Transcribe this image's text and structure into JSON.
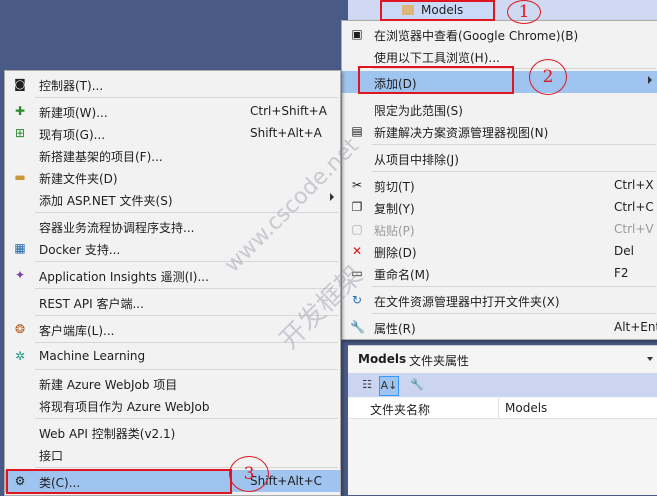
{
  "solution": {
    "models_label": "Models"
  },
  "right_menu": {
    "items": [
      {
        "label": "在浏览器中查看(Google Chrome)(B)",
        "shortcut": "",
        "icon": "browser-icon"
      },
      {
        "label": "使用以下工具浏览(H)...",
        "shortcut": "",
        "icon": ""
      },
      {
        "label": "添加(D)",
        "shortcut": "",
        "icon": ""
      },
      {
        "label": "限定为此范围(S)",
        "shortcut": "",
        "icon": ""
      },
      {
        "label": "新建解决方案资源管理器视图(N)",
        "shortcut": "",
        "icon": "solution-view-icon"
      },
      {
        "label": "从项目中排除(J)",
        "shortcut": "",
        "icon": ""
      },
      {
        "label": "剪切(T)",
        "shortcut": "Ctrl+X",
        "icon": "cut-icon"
      },
      {
        "label": "复制(Y)",
        "shortcut": "Ctrl+C",
        "icon": "copy-icon"
      },
      {
        "label": "粘贴(P)",
        "shortcut": "Ctrl+V",
        "icon": "paste-icon"
      },
      {
        "label": "删除(D)",
        "shortcut": "Del",
        "icon": "delete-icon"
      },
      {
        "label": "重命名(M)",
        "shortcut": "F2",
        "icon": "rename-icon"
      },
      {
        "label": "在文件资源管理器中打开文件夹(X)",
        "shortcut": "",
        "icon": "open-folder-icon"
      },
      {
        "label": "属性(R)",
        "shortcut": "Alt+Enter",
        "icon": "properties-icon"
      }
    ]
  },
  "left_menu": {
    "items": [
      {
        "label": "控制器(T)...",
        "shortcut": "",
        "icon": "controller-icon"
      },
      {
        "label": "新建项(W)...",
        "shortcut": "Ctrl+Shift+A",
        "icon": "new-item-icon"
      },
      {
        "label": "现有项(G)...",
        "shortcut": "Shift+Alt+A",
        "icon": "existing-item-icon"
      },
      {
        "label": "新搭建基架的项目(F)...",
        "shortcut": "",
        "icon": ""
      },
      {
        "label": "新建文件夹(D)",
        "shortcut": "",
        "icon": "new-folder-icon"
      },
      {
        "label": "添加 ASP.NET 文件夹(S)",
        "shortcut": "",
        "icon": ""
      },
      {
        "label": "容器业务流程协调程序支持...",
        "shortcut": "",
        "icon": ""
      },
      {
        "label": "Docker 支持...",
        "shortcut": "",
        "icon": "docker-icon"
      },
      {
        "label": "Application Insights 遥测(I)...",
        "shortcut": "",
        "icon": "insights-icon"
      },
      {
        "label": "REST API 客户端...",
        "shortcut": "",
        "icon": ""
      },
      {
        "label": "客户端库(L)...",
        "shortcut": "",
        "icon": "client-library-icon"
      },
      {
        "label": "Machine Learning",
        "shortcut": "",
        "icon": "ml-icon"
      },
      {
        "label": "新建 Azure WebJob 项目",
        "shortcut": "",
        "icon": ""
      },
      {
        "label": "将现有项目作为 Azure WebJob",
        "shortcut": "",
        "icon": ""
      },
      {
        "label": "Web API 控制器类(v2.1)",
        "shortcut": "",
        "icon": ""
      },
      {
        "label": "接口",
        "shortcut": "",
        "icon": ""
      },
      {
        "label": "类(C)...",
        "shortcut": "Shift+Alt+C",
        "icon": "class-icon"
      }
    ]
  },
  "properties": {
    "title": "Models",
    "subtitle": "文件夹属性",
    "row_key": "文件夹名称",
    "row_value": "Models"
  },
  "annotations": [
    "1",
    "2",
    "3"
  ],
  "watermark": {
    "line1": "www.cscode.net",
    "line2": "开发框架"
  }
}
